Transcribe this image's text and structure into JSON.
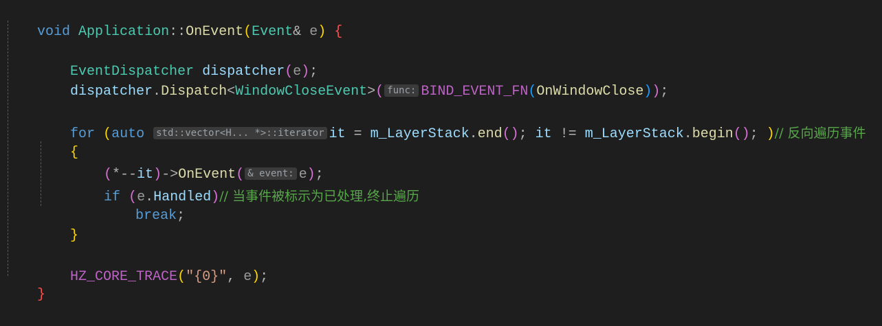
{
  "code": {
    "l1": {
      "kw": "void",
      "cls": "Application",
      "sep": "::",
      "fn": "OnEvent",
      "open": "(",
      "ptype": "Event",
      "amp": "&",
      "pname": "e",
      "close": ")",
      "brace": "{"
    },
    "l3": {
      "type": "EventDispatcher",
      "var": "dispatcher",
      "open": "(",
      "arg": "e",
      "close": ")",
      "semi": ";"
    },
    "l4": {
      "obj": "dispatcher",
      "dot": ".",
      "fn": "Dispatch",
      "lt": "<",
      "tmpl": "WindowCloseEvent",
      "gt": ">",
      "open": "(",
      "hint": "func:",
      "macro": "BIND_EVENT_FN",
      "mopen": "(",
      "marg": "OnWindowClose",
      "mclose": ")",
      "close": ")",
      "semi": ";"
    },
    "l6": {
      "kw": "for",
      "open": "(",
      "auto": "auto",
      "hint": "std::vector<H... *>::iterator",
      "it": "it",
      "eq": " = ",
      "obj1": "m_LayerStack",
      "dot1": ".",
      "fn1": "end",
      "call1": "()",
      "semi1": "; ",
      "it2": "it",
      "neq": " != ",
      "obj2": "m_LayerStack",
      "dot2": ".",
      "fn2": "begin",
      "call2": "()",
      "semi2": "; ",
      "close": ")",
      "comment": "// 反向遍历事件"
    },
    "l7": {
      "brace": "{"
    },
    "l8": {
      "open": "(",
      "deref": "*--",
      "it": "it",
      "close": ")",
      "arrow": "->",
      "fn": "OnEvent",
      "copen": "(",
      "hint": "& event:",
      "arg": "e",
      "cclose": ")",
      "semi": ";"
    },
    "l9": {
      "kw": "if",
      "open": "(",
      "obj": "e",
      "dot": ".",
      "mem": "Handled",
      "close": ")",
      "comment": "// 当事件被标示为已处理,终止遍历"
    },
    "l10": {
      "kw": "break",
      "semi": ";"
    },
    "l11": {
      "brace": "}"
    },
    "l13": {
      "macro": "HZ_CORE_TRACE",
      "open": "(",
      "str": "\"{0}\"",
      "comma": ",",
      "arg": "e",
      "close": ")",
      "semi": ";"
    },
    "l14": {
      "brace": "}"
    }
  }
}
